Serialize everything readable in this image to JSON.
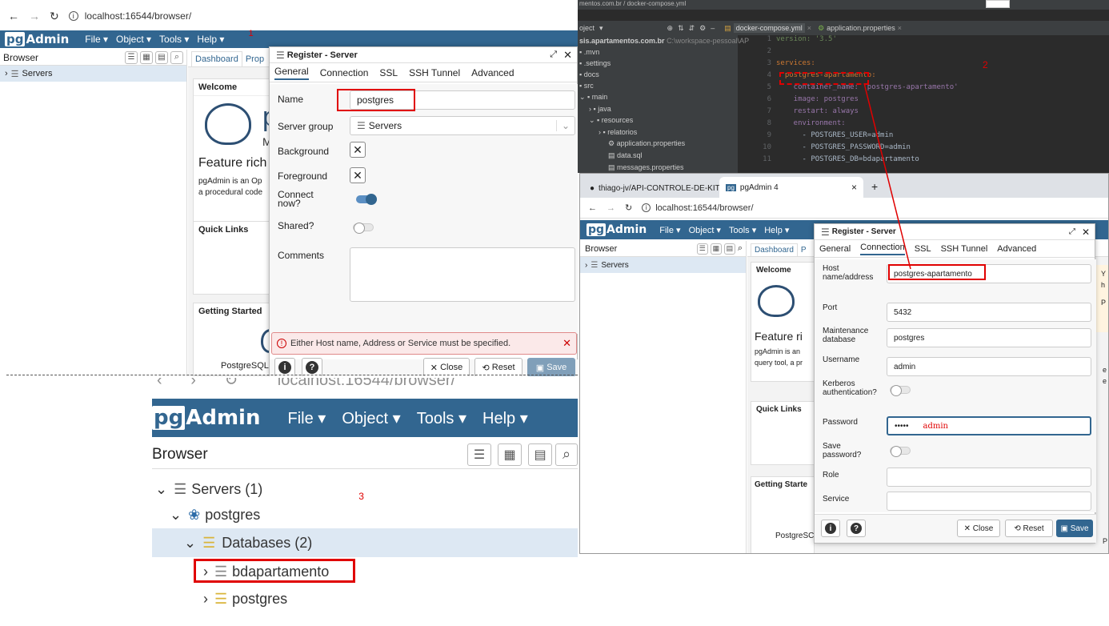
{
  "panel1": {
    "address": "localhost:16544/browser/",
    "annotation": "1",
    "menu": [
      "File ▾",
      "Object ▾",
      "Tools ▾",
      "Help ▾"
    ],
    "browser_title": "Browser",
    "tree_servers": "Servers",
    "tabs": [
      "Dashboard",
      "Prop"
    ],
    "welcome_title": "Welcome",
    "feature_rich": "Feature rich",
    "welcome_text_1": "pgAdmin is an Op",
    "welcome_text_2": "a procedural code",
    "big_letter": "p",
    "small_letter": "M",
    "quick_links": "Quick Links",
    "getting_started": "Getting Started",
    "postgresql": "PostgreSQL",
    "dialog": {
      "title": "Register - Server",
      "tabs": [
        "General",
        "Connection",
        "SSL",
        "SSH Tunnel",
        "Advanced"
      ],
      "name_label": "Name",
      "name_value": "postgres",
      "server_group_label": "Server group",
      "server_group_value": "Servers",
      "background_label": "Background",
      "foreground_label": "Foreground",
      "connect_now_label": "Connect now?",
      "shared_label": "Shared?",
      "comments_label": "Comments",
      "error": "Either Host name, Address or Service must be specified.",
      "close": "Close",
      "reset": "Reset",
      "save": "Save"
    }
  },
  "panel2": {
    "title_tab_1": "docker-compose.yml",
    "title_tab_2": "application.properties",
    "top_breadcrumb": "mentos.com.br / docker-compose.yml",
    "project_label": "oject",
    "project_root": "sis.apartamentos.com.br",
    "project_path": "C:\\workspace-pessoal\\AP",
    "annotation": "2",
    "tree": [
      ".mvn",
      ".settings",
      "docs",
      "src",
      "main",
      "java",
      "resources",
      "relatorios",
      "application.properties",
      "data.sql",
      "messages.properties"
    ],
    "line_numbers": [
      "1",
      "2",
      "3",
      "4",
      "5",
      "6",
      "7",
      "8",
      "9",
      "10",
      "11"
    ],
    "code_lines": [
      "version: '3.5'",
      "",
      "services:",
      "  postgres-apartamento:",
      "    container_name: 'postgres-apartamento'",
      "    image: postgres",
      "    restart: always",
      "    environment:",
      "      - POSTGRES_USER=admin",
      "      - POSTGRES_PASSWORD=admin",
      "      - POSTGRES_DB=bdapartamento"
    ]
  },
  "panel3": {
    "browser_tab_1": "thiago-jv/API-CONTROLE-DE-KIT",
    "browser_tab_2": "pgAdmin 4",
    "address": "localhost:16544/browser/",
    "menu": [
      "File ▾",
      "Object ▾",
      "Tools ▾",
      "Help ▾"
    ],
    "browser_title": "Browser",
    "tree_servers": "Servers",
    "tabs": [
      "Dashboard",
      "P"
    ],
    "welcome_title": "Welcome",
    "feature_rich": "Feature ri",
    "welcome_text_1": "pgAdmin is an",
    "welcome_text_2": "query tool, a pr",
    "quick_links": "Quick Links",
    "getting_started": "Getting Starte",
    "postgresql": "PostgreSC",
    "right_edge_1": "Y",
    "right_edge_2": "h",
    "right_edge_3": "P",
    "right_edge_4": "e",
    "right_edge_5": "e",
    "right_edge_6": "P",
    "dialog": {
      "title": "Register - Server",
      "tabs": [
        "General",
        "Connection",
        "SSL",
        "SSH Tunnel",
        "Advanced"
      ],
      "host_label": "Host name/address",
      "host_value": "postgres-apartamento",
      "port_label": "Port",
      "port_value": "5432",
      "maint_label": "Maintenance database",
      "maint_value": "postgres",
      "username_label": "Username",
      "username_value": "admin",
      "kerberos_label": "Kerberos authentication?",
      "password_label": "Password",
      "password_dots": "•••••",
      "password_hint": "admin",
      "save_password_label": "Save password?",
      "role_label": "Role",
      "service_label": "Service",
      "close": "Close",
      "reset": "Reset",
      "save": "Save"
    }
  },
  "panel4": {
    "address_overlay": "localhost:16544/browser/",
    "menu": [
      "File ▾",
      "Object ▾",
      "Tools ▾",
      "Help ▾"
    ],
    "browser_title": "Browser",
    "annotation": "3",
    "tree": {
      "servers": "Servers (1)",
      "postgres": "postgres",
      "databases": "Databases (2)",
      "db1": "bdapartamento",
      "db2": "postgres"
    }
  },
  "colors": {
    "navbar": "#326690",
    "annotation_red": "#e00000",
    "ide_bg": "#2b2b2b"
  }
}
